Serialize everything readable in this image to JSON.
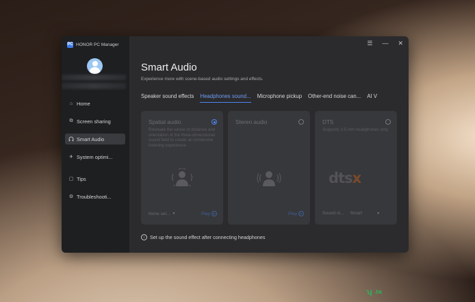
{
  "window": {
    "app_name": "HONOR PC Manager",
    "logo_text": "PC",
    "controls": {
      "menu": "☰",
      "minimize": "—",
      "close": "✕"
    }
  },
  "sidebar": {
    "items": [
      {
        "label": "Home",
        "icon": "home-icon",
        "glyph": "⌂",
        "active": false
      },
      {
        "label": "Screen sharing",
        "icon": "screen-share-icon",
        "glyph": "⧉",
        "active": false
      },
      {
        "label": "Smart Audio",
        "icon": "headphones-icon",
        "glyph": "🎧",
        "active": true
      },
      {
        "label": "System optimi...",
        "icon": "rocket-icon",
        "glyph": "✈",
        "active": false
      },
      {
        "label": "Tips",
        "icon": "book-icon",
        "glyph": "▢",
        "active": false
      },
      {
        "label": "Troubleshooti...",
        "icon": "wrench-icon",
        "glyph": "⚙",
        "active": false
      }
    ]
  },
  "main": {
    "title": "Smart Audio",
    "subtitle": "Experience more with scene-based audio settings and effects.",
    "tabs": [
      {
        "label": "Speaker sound effects",
        "active": false
      },
      {
        "label": "Headphones sound...",
        "active": true
      },
      {
        "label": "Microphone pickup",
        "active": false
      },
      {
        "label": "Other-end noise can...",
        "active": false
      },
      {
        "label": "AI V",
        "active": false
      }
    ],
    "cards": [
      {
        "title": "Spatial audio",
        "desc": "Recreate the sense of distance and orientation of the three-dimensional sound field to create an immersive listening experience.",
        "selected": true,
        "select_value": "None sel...",
        "play_label": "Play"
      },
      {
        "title": "Stereo audio",
        "desc": "",
        "selected": false,
        "play_label": "Play"
      },
      {
        "title": "DTS",
        "desc": "Supports 3.5 mm headphones only",
        "selected": false,
        "logo_text_a": "dts",
        "logo_text_b": "x",
        "foot_label": "Sound st...",
        "select_value": "Smart"
      }
    ],
    "notice": "Set up the sound effect after connecting headphones",
    "colors": {
      "accent": "#4f86ee",
      "panel": "#2b2b2d",
      "card": "#37383b"
    }
  },
  "watermark": {
    "text_a": "",
    "text_b": ".hk"
  }
}
